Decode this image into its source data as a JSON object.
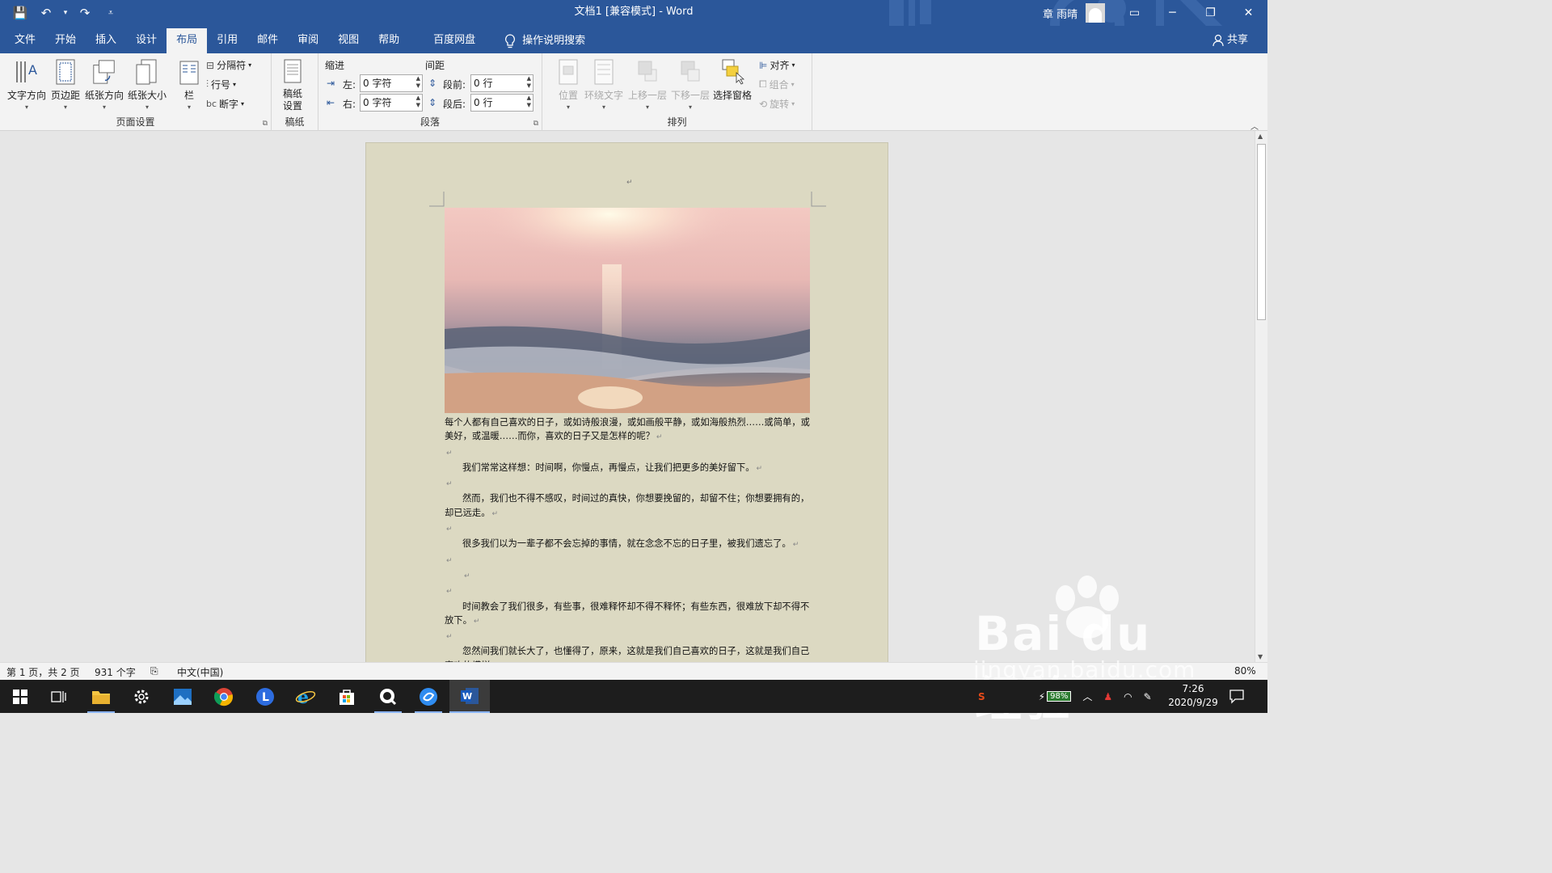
{
  "titlebar": {
    "doc_title": "文档1 [兼容模式] - Word",
    "user_name": "章 雨晴",
    "qat": {
      "save": "💾",
      "undo": "↶",
      "undo_dropdown": "▾",
      "redo": "↷",
      "customize": "⩡"
    },
    "window": {
      "ribbon_display": "▭",
      "minimize": "─",
      "restore": "❐",
      "close": "✕"
    }
  },
  "tabs": [
    {
      "label": "文件"
    },
    {
      "label": "开始"
    },
    {
      "label": "插入"
    },
    {
      "label": "设计"
    },
    {
      "label": "布局"
    },
    {
      "label": "引用"
    },
    {
      "label": "邮件"
    },
    {
      "label": "审阅"
    },
    {
      "label": "视图"
    },
    {
      "label": "帮助"
    },
    {
      "label": "百度网盘"
    }
  ],
  "active_tab": "布局",
  "tell_me": "操作说明搜索",
  "share": "共享",
  "ribbon": {
    "page_setup": {
      "label": "页面设置",
      "text_direction": "文字方向",
      "margins": "页边距",
      "orientation": "纸张方向",
      "size": "纸张大小",
      "columns": "栏",
      "breaks": "分隔符",
      "line_numbers": "行号",
      "hyphenation": "断字"
    },
    "manuscript": {
      "label": "稿纸",
      "button_line1": "稿纸",
      "button_line2": "设置"
    },
    "paragraph": {
      "label": "段落",
      "indent_header": "缩进",
      "spacing_header": "间距",
      "indent_left_label": "左:",
      "indent_left_value": "0 字符",
      "indent_right_label": "右:",
      "indent_right_value": "0 字符",
      "before_label": "段前:",
      "before_value": "0 行",
      "after_label": "段后:",
      "after_value": "0 行"
    },
    "arrange": {
      "label": "排列",
      "position": "位置",
      "wrap_text": "环绕文字",
      "bring_forward": "上移一层",
      "send_backward": "下移一层",
      "selection_pane": "选择窗格",
      "align": "对齐",
      "group": "组合",
      "rotate": "旋转"
    }
  },
  "document": {
    "paragraph_mark": "↵",
    "paragraphs": [
      {
        "text": "每个人都有自己喜欢的日子，或如诗般浪漫，或如画般平静，或如海般热烈……或简单，或美好，或温暖……而你，喜欢的日子又是怎样的呢？",
        "indent": false
      },
      {
        "text": "",
        "indent": false
      },
      {
        "text": "我们常常这样想：时间啊，你慢点，再慢点，让我们把更多的美好留下。",
        "indent": true
      },
      {
        "text": "",
        "indent": false
      },
      {
        "text": "然而，我们也不得不感叹，时间过的真快，你想要挽留的，却留不住；你想要拥有的，却已远走。",
        "indent": true
      },
      {
        "text": "",
        "indent": false
      },
      {
        "text": "很多我们以为一辈子都不会忘掉的事情，就在念念不忘的日子里，被我们遗忘了。",
        "indent": true
      },
      {
        "text": "",
        "indent": false
      },
      {
        "text": "",
        "indent": true
      },
      {
        "text": "",
        "indent": false
      },
      {
        "text": "时间教会了我们很多，有些事，很难释怀却不得不释怀；有些东西，很难放下却不得不放下。",
        "indent": true
      },
      {
        "text": "",
        "indent": false
      },
      {
        "text": "忽然间我们就长大了，也懂得了，原来，这就是我们自己喜欢的日子，这就是我们自己喜欢的模样。",
        "indent": true
      },
      {
        "text": "",
        "indent": false
      }
    ]
  },
  "statusbar": {
    "page_info": "第 1 页，共 2 页",
    "word_count": "931 个字",
    "language": "中文(中国)",
    "zoom": "80%"
  },
  "taskbar": {
    "battery": "98%",
    "time": "7:26",
    "date": "2020/9/29"
  },
  "watermark": {
    "text": "Bai du 经验",
    "sub": "jingyan.baidu.com"
  },
  "colors": {
    "accent": "#2b579a",
    "page": "#dcd9c2",
    "ribbon": "#f3f3f3",
    "taskbar": "#1d1d1d"
  }
}
